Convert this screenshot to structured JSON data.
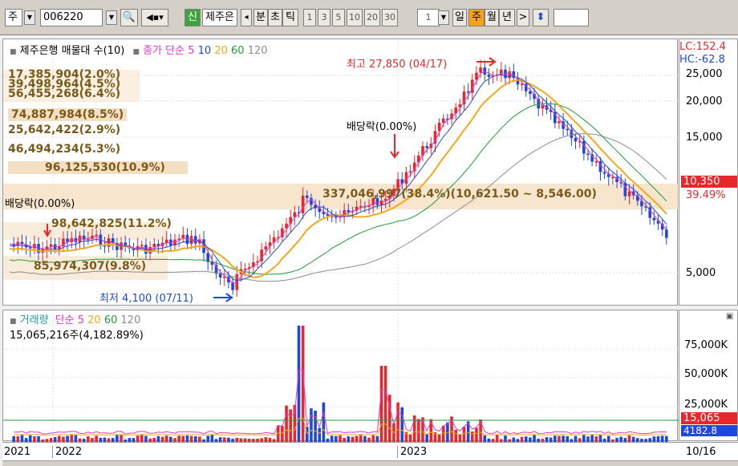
{
  "toolbar": {
    "market_select": "주",
    "stock_code": "006220",
    "credit_badge": "신",
    "stock_name": "제주은",
    "period_prev": "◂",
    "period_labels": [
      "분",
      "초",
      "틱"
    ],
    "interval_buttons": [
      "1",
      "3",
      "5",
      "10",
      "20",
      "30"
    ],
    "interval_value": "1",
    "timeframe_buttons": [
      "일",
      "주",
      "월",
      "년"
    ],
    "active_timeframe": "주",
    "next_arrow": ">",
    "sort_icon": "⬍"
  },
  "price_pane": {
    "legend_title": "제주은행 매물대 수(10)",
    "legend_ma_title": "종가 단순 5",
    "legend_ma_periods": [
      "10",
      "20",
      "60",
      "120"
    ],
    "high_label": "최고 27,850 (04/17)",
    "low_label": "최저 4,100 (07/11)",
    "ex_dividend_label_1": "배당락(0.00%)",
    "ex_dividend_label_2": "배당락(0.00%)",
    "volume_profile_labels": [
      "17,385,904(2.0%)",
      "39,498,964(4.5%)",
      "56,455,268(6.4%)",
      "74,887,984(8.5%)",
      "25,642,422(2.9%)",
      "46,494,234(5.3%)",
      "96,125,530(10.9%)",
      "337,046,997(38.4%)(10,621.50 ~ 8,546.00)",
      "98,642,825(11.2%)",
      "85,974,307(9.8%)"
    ],
    "lc_label": "LC:152.4",
    "hc_label": "HC:-62.8",
    "current_price": "10,350",
    "current_change": "39.49%",
    "y_ticks": [
      "25,000",
      "20,000",
      "15,000",
      "5,000"
    ]
  },
  "volume_pane": {
    "legend_title": "거래량",
    "legend_ma_title": "단순 5",
    "legend_ma_periods": [
      "20",
      "60",
      "120"
    ],
    "info_line": "15,065,216주(4,182.89%)",
    "y_ticks": [
      "75,000K",
      "50,000K",
      "25,000K"
    ],
    "current_volume": "15,065",
    "current_volume_pct": "4182.8"
  },
  "date_axis": {
    "labels": [
      "2021",
      "2022",
      "2023"
    ],
    "right_label": "10/16"
  },
  "colors": {
    "up": "#e8272b",
    "down": "#1e49d8",
    "ma5": "#e535c8",
    "ma10": "#1e49d8",
    "ma20": "#f0a91d",
    "ma60": "#1f9b3a",
    "ma120": "#8c8c8c",
    "profile_band": "#f5dfc2",
    "active_tab": "#f7a21b"
  }
}
